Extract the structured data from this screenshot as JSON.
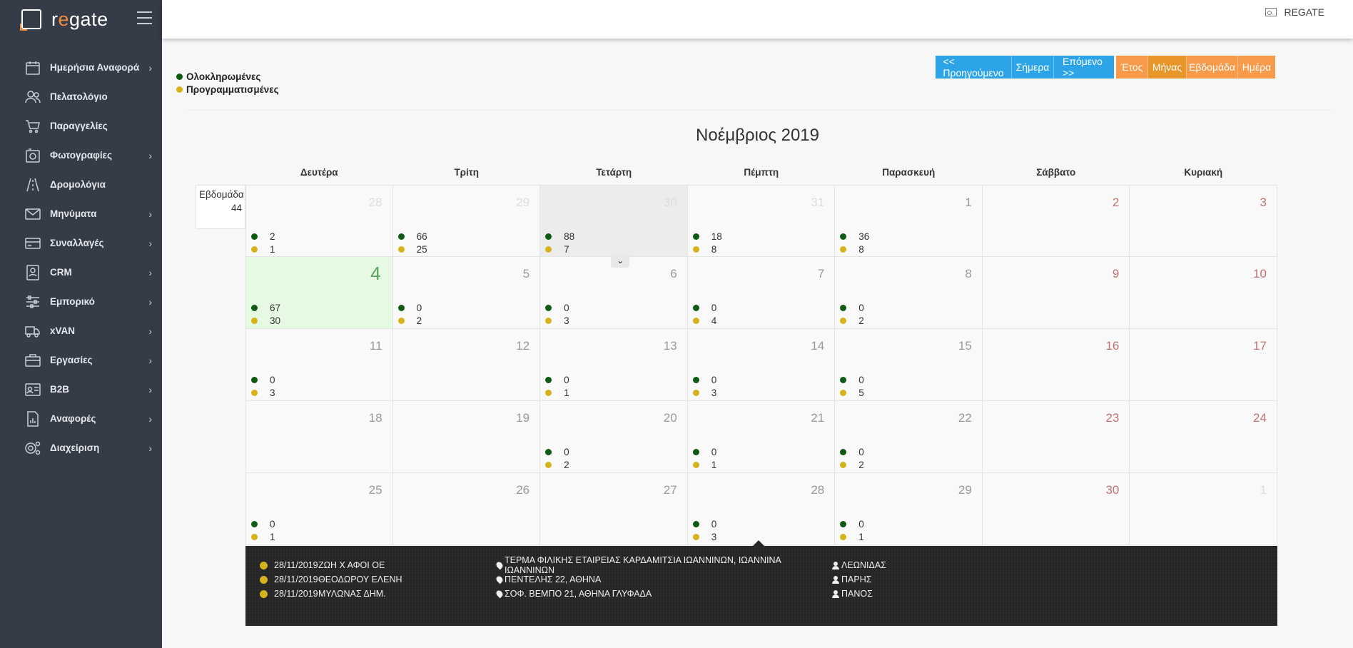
{
  "app": {
    "logo_prefix": "r",
    "logo_accent": "e",
    "logo_suffix": "gate",
    "user_label": "REGATE"
  },
  "sidebar": {
    "items": [
      {
        "label": "Ημερήσια Αναφορά",
        "icon": "calendar-icon",
        "has_submenu": true
      },
      {
        "label": "Πελατολόγιο",
        "icon": "users-icon",
        "has_submenu": false
      },
      {
        "label": "Παραγγελίες",
        "icon": "cart-icon",
        "has_submenu": false
      },
      {
        "label": "Φωτογραφίες",
        "icon": "camera-icon",
        "has_submenu": true
      },
      {
        "label": "Δρομολόγια",
        "icon": "road-icon",
        "has_submenu": false
      },
      {
        "label": "Μηνύματα",
        "icon": "envelope-icon",
        "has_submenu": true
      },
      {
        "label": "Συναλλαγές",
        "icon": "credit-card-icon",
        "has_submenu": true
      },
      {
        "label": "CRM",
        "icon": "contact-card-icon",
        "has_submenu": true
      },
      {
        "label": "Εμπορικό",
        "icon": "sliders-icon",
        "has_submenu": true
      },
      {
        "label": "xVAN",
        "icon": "truck-icon",
        "has_submenu": true
      },
      {
        "label": "Εργασίες",
        "icon": "briefcase-icon",
        "has_submenu": true
      },
      {
        "label": "B2B",
        "icon": "id-card-icon",
        "has_submenu": true
      },
      {
        "label": "Αναφορές",
        "icon": "report-icon",
        "has_submenu": true
      },
      {
        "label": "Διαχείριση",
        "icon": "gears-icon",
        "has_submenu": true
      }
    ]
  },
  "legend": {
    "completed": "Ολοκληρωμένες",
    "scheduled": "Προγραμματισμένες"
  },
  "nav_buttons": {
    "prev": "<< Προηγούμενο",
    "today": "Σήμερα",
    "next": "Επόμενο >>"
  },
  "view_buttons": {
    "year": "Έτος",
    "month": "Μήνας",
    "week": "Εβδομάδα",
    "day": "Ημέρα",
    "active": "month"
  },
  "colors": {
    "sidebar_bg": "#353c47",
    "primary_blue": "#2ea4e8",
    "orange": "#f79b4b",
    "completed_green": "#0f5a12",
    "scheduled_yellow": "#d6b31c",
    "today_bg": "#e6f9e3"
  },
  "calendar": {
    "title": "Νοέμβριος 2019",
    "weekdays": [
      "Δευτέρα",
      "Τρίτη",
      "Τετάρτη",
      "Πέμπτη",
      "Παρασκευή",
      "Σάββατο",
      "Κυριακή"
    ],
    "week_label": "Εβδομάδα",
    "week_number": "44",
    "weeks": [
      [
        {
          "day": "28",
          "other": true,
          "completed": "2",
          "scheduled": "1"
        },
        {
          "day": "29",
          "other": true,
          "completed": "66",
          "scheduled": "25"
        },
        {
          "day": "30",
          "other": true,
          "selected": true,
          "completed": "88",
          "scheduled": "7"
        },
        {
          "day": "31",
          "other": true,
          "completed": "18",
          "scheduled": "8"
        },
        {
          "day": "1",
          "completed": "36",
          "scheduled": "8"
        },
        {
          "day": "2",
          "weekend": true
        },
        {
          "day": "3",
          "weekend": true
        }
      ],
      [
        {
          "day": "4",
          "today": true,
          "completed": "67",
          "scheduled": "30"
        },
        {
          "day": "5",
          "completed": "0",
          "scheduled": "2"
        },
        {
          "day": "6",
          "completed": "0",
          "scheduled": "3"
        },
        {
          "day": "7",
          "completed": "0",
          "scheduled": "4"
        },
        {
          "day": "8",
          "completed": "0",
          "scheduled": "2"
        },
        {
          "day": "9",
          "weekend": true
        },
        {
          "day": "10",
          "weekend": true
        }
      ],
      [
        {
          "day": "11",
          "completed": "0",
          "scheduled": "3"
        },
        {
          "day": "12"
        },
        {
          "day": "13",
          "completed": "0",
          "scheduled": "1"
        },
        {
          "day": "14",
          "completed": "0",
          "scheduled": "3"
        },
        {
          "day": "15",
          "completed": "0",
          "scheduled": "5"
        },
        {
          "day": "16",
          "weekend": true
        },
        {
          "day": "17",
          "weekend": true
        }
      ],
      [
        {
          "day": "18"
        },
        {
          "day": "19"
        },
        {
          "day": "20",
          "completed": "0",
          "scheduled": "2"
        },
        {
          "day": "21",
          "completed": "0",
          "scheduled": "1"
        },
        {
          "day": "22",
          "completed": "0",
          "scheduled": "2"
        },
        {
          "day": "23",
          "weekend": true
        },
        {
          "day": "24",
          "weekend": true
        }
      ],
      [
        {
          "day": "25",
          "completed": "0",
          "scheduled": "1"
        },
        {
          "day": "26"
        },
        {
          "day": "27"
        },
        {
          "day": "28",
          "completed": "0",
          "scheduled": "3"
        },
        {
          "day": "29",
          "completed": "0",
          "scheduled": "1"
        },
        {
          "day": "30",
          "weekend": true
        },
        {
          "day": "1",
          "other": true
        }
      ]
    ]
  },
  "detail": {
    "events": [
      {
        "date": "28/11/2019",
        "name": "ΖΩΗ Χ ΑΦΟΙ ΟΕ",
        "location": "ΤΕΡΜΑ ΦΙΛΙΚΗΣ ΕΤΑΙΡΕΙΑΣ ΚΑΡΔΑΜΙΤΣΙΑ ΙΩΑΝΝΙΝΩΝ, ΙΩΑΝΝΙΝΑ ΙΩΑΝΝΙΝΩΝ",
        "user": "ΛΕΩΝΙΔΑΣ"
      },
      {
        "date": "28/11/2019",
        "name": "ΘΕΟΔΩΡΟΥ ΕΛΕΝΗ",
        "location": "ΠΕΝΤΕΛΗΣ 22, ΑΘΗΝΑ",
        "user": "ΠΑΡΗΣ"
      },
      {
        "date": "28/11/2019",
        "name": "ΜΥΛΩΝΑΣ ΔΗΜ.",
        "location": "ΣΟΦ. ΒΕΜΠΟ 21, ΑΘΗΝΑ ΓΛΥΦΑΔΑ",
        "user": "ΠΑΝΟΣ"
      }
    ]
  }
}
